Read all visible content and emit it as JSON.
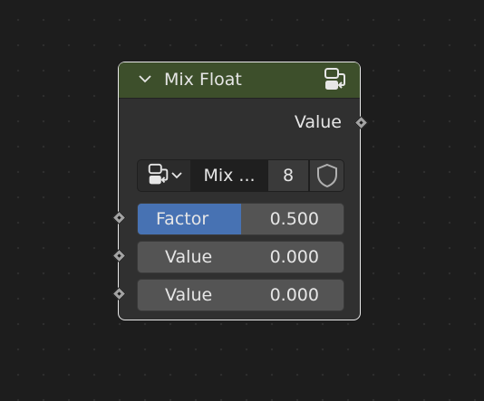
{
  "node": {
    "title": "Mix Float",
    "header_color": "#3d4f2b",
    "output_label": "Value",
    "group_icon": "node-group-icon",
    "selector": {
      "browse_icon": "node-group-icon",
      "name": "Mix ...",
      "users": "8",
      "fake_user_icon": "shield-icon"
    },
    "inputs": [
      {
        "label": "Factor",
        "value": "0.500",
        "fill": 0.5,
        "accent": "#4772b3"
      },
      {
        "label": "Value",
        "value": "0.000"
      },
      {
        "label": "Value",
        "value": "0.000"
      }
    ]
  }
}
